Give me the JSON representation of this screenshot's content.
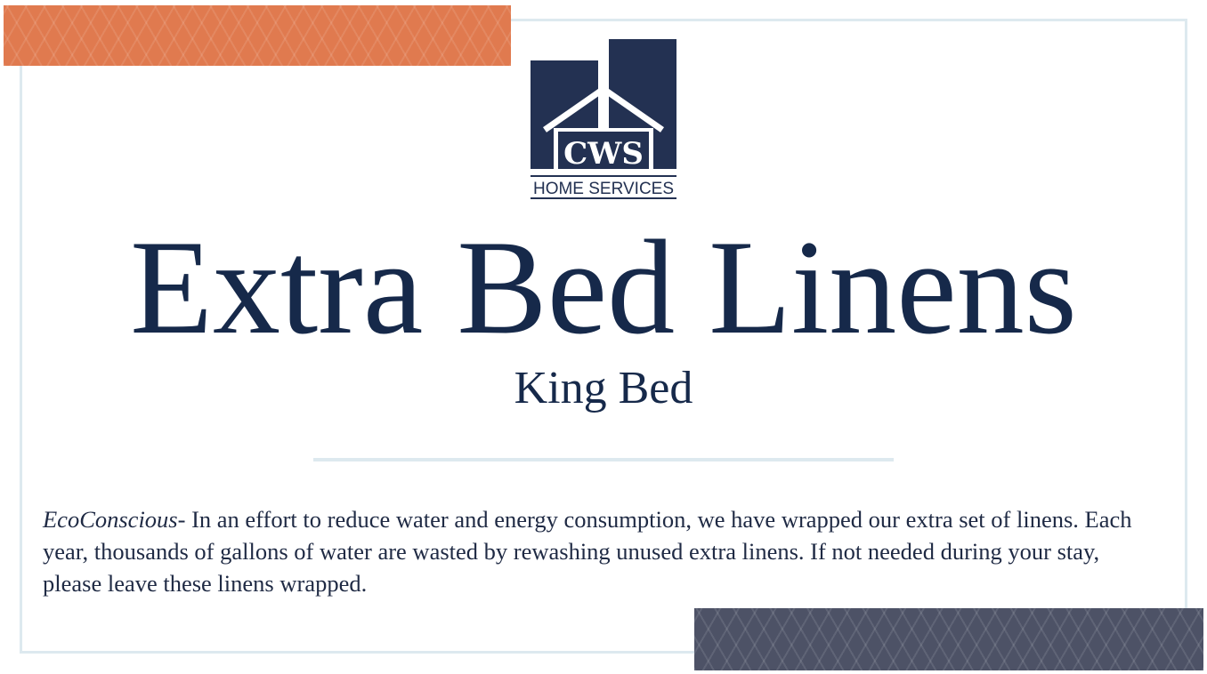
{
  "logo": {
    "brand": "CWS",
    "tagline": "HOME SERVICES"
  },
  "sign": {
    "title": "Extra Bed Linens",
    "subtitle": "King Bed",
    "note_lead": "EcoConscious",
    "note_text": "- In an effort to reduce water and energy consumption, we have wrapped our extra set of linens. Each year, thousands of gallons of water are wasted by rewashing unused extra linens. If not needed during your stay, please leave these linens wrapped."
  },
  "colors": {
    "navy": "#233152",
    "text": "#16294a",
    "orange": "#e07a4f",
    "slate": "#4d5266",
    "frame": "#dde9ef"
  }
}
